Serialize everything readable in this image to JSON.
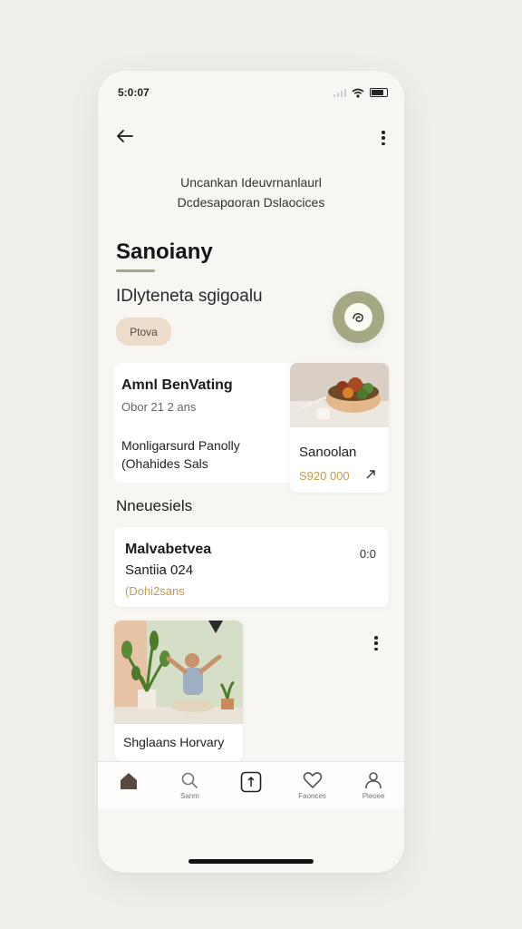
{
  "status_bar": {
    "time": "5:0:07"
  },
  "header": {
    "subtitle_line1": "Uncankan Ideuvrnanlaurl",
    "subtitle_line2": "Dcdesapɑoran Dslaocices"
  },
  "profile": {
    "title": "Sanoiany",
    "subtitle": "IDlyteneta sgigoalu",
    "chip_label": "Ptova"
  },
  "card_main": {
    "title": "Amnl BenVating",
    "meta": "Obor 21 2 ans",
    "line1": "Monligarsurd Panolly",
    "line2": "(Ohahides Sals"
  },
  "card_food": {
    "title": "Sanoolan",
    "price": "S920 000"
  },
  "section": {
    "title": "Nneuesiels"
  },
  "card_wide": {
    "title": "Malvabetvea",
    "subtitle": "Santiia 024",
    "meta": "(Dohi2sans",
    "right_value": "0:0"
  },
  "card_person": {
    "title": "Shglaans Horvary"
  },
  "nav": {
    "items": [
      {
        "label": "",
        "icon": "home-icon"
      },
      {
        "label": "Sanm",
        "icon": "search-icon"
      },
      {
        "label": "",
        "icon": "add-square-icon"
      },
      {
        "label": "Faonces",
        "icon": "heart-icon"
      },
      {
        "label": "Pleoee",
        "icon": "profile-icon"
      }
    ]
  },
  "colors": {
    "accent_olive": "#a6a783",
    "chip_bg": "#ecdccc",
    "price_gold": "#c49a52",
    "background": "#f7f6f2"
  }
}
